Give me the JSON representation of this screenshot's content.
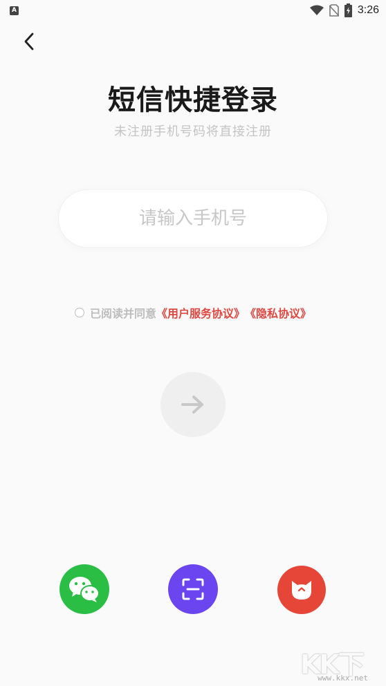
{
  "status_bar": {
    "app_icon_letter": "A",
    "time": "3:26",
    "icons": [
      "wifi-icon",
      "no-sim-icon",
      "battery-charging-icon"
    ]
  },
  "header": {
    "back_icon": "chevron-left-icon",
    "title": "短信快捷登录",
    "subtitle": "未注册手机号码将直接注册"
  },
  "phone_input": {
    "placeholder": "请输入手机号",
    "value": ""
  },
  "agreement": {
    "prefix": "已阅读并同意",
    "user_agreement": "《用户服务协议》",
    "privacy_policy": "《隐私协议》",
    "checked": false,
    "link_color": "#e0473f"
  },
  "next_button": {
    "icon": "arrow-right-icon"
  },
  "third_party_login": [
    {
      "name": "wechat",
      "icon": "wechat-icon",
      "color": "#2bbe45"
    },
    {
      "name": "scan",
      "icon": "scan-icon",
      "color": "#6a45f0"
    },
    {
      "name": "cat",
      "icon": "cat-face-icon",
      "color": "#e64638"
    }
  ],
  "watermark": {
    "text": "KK下载",
    "url": "www.kkx.net"
  }
}
